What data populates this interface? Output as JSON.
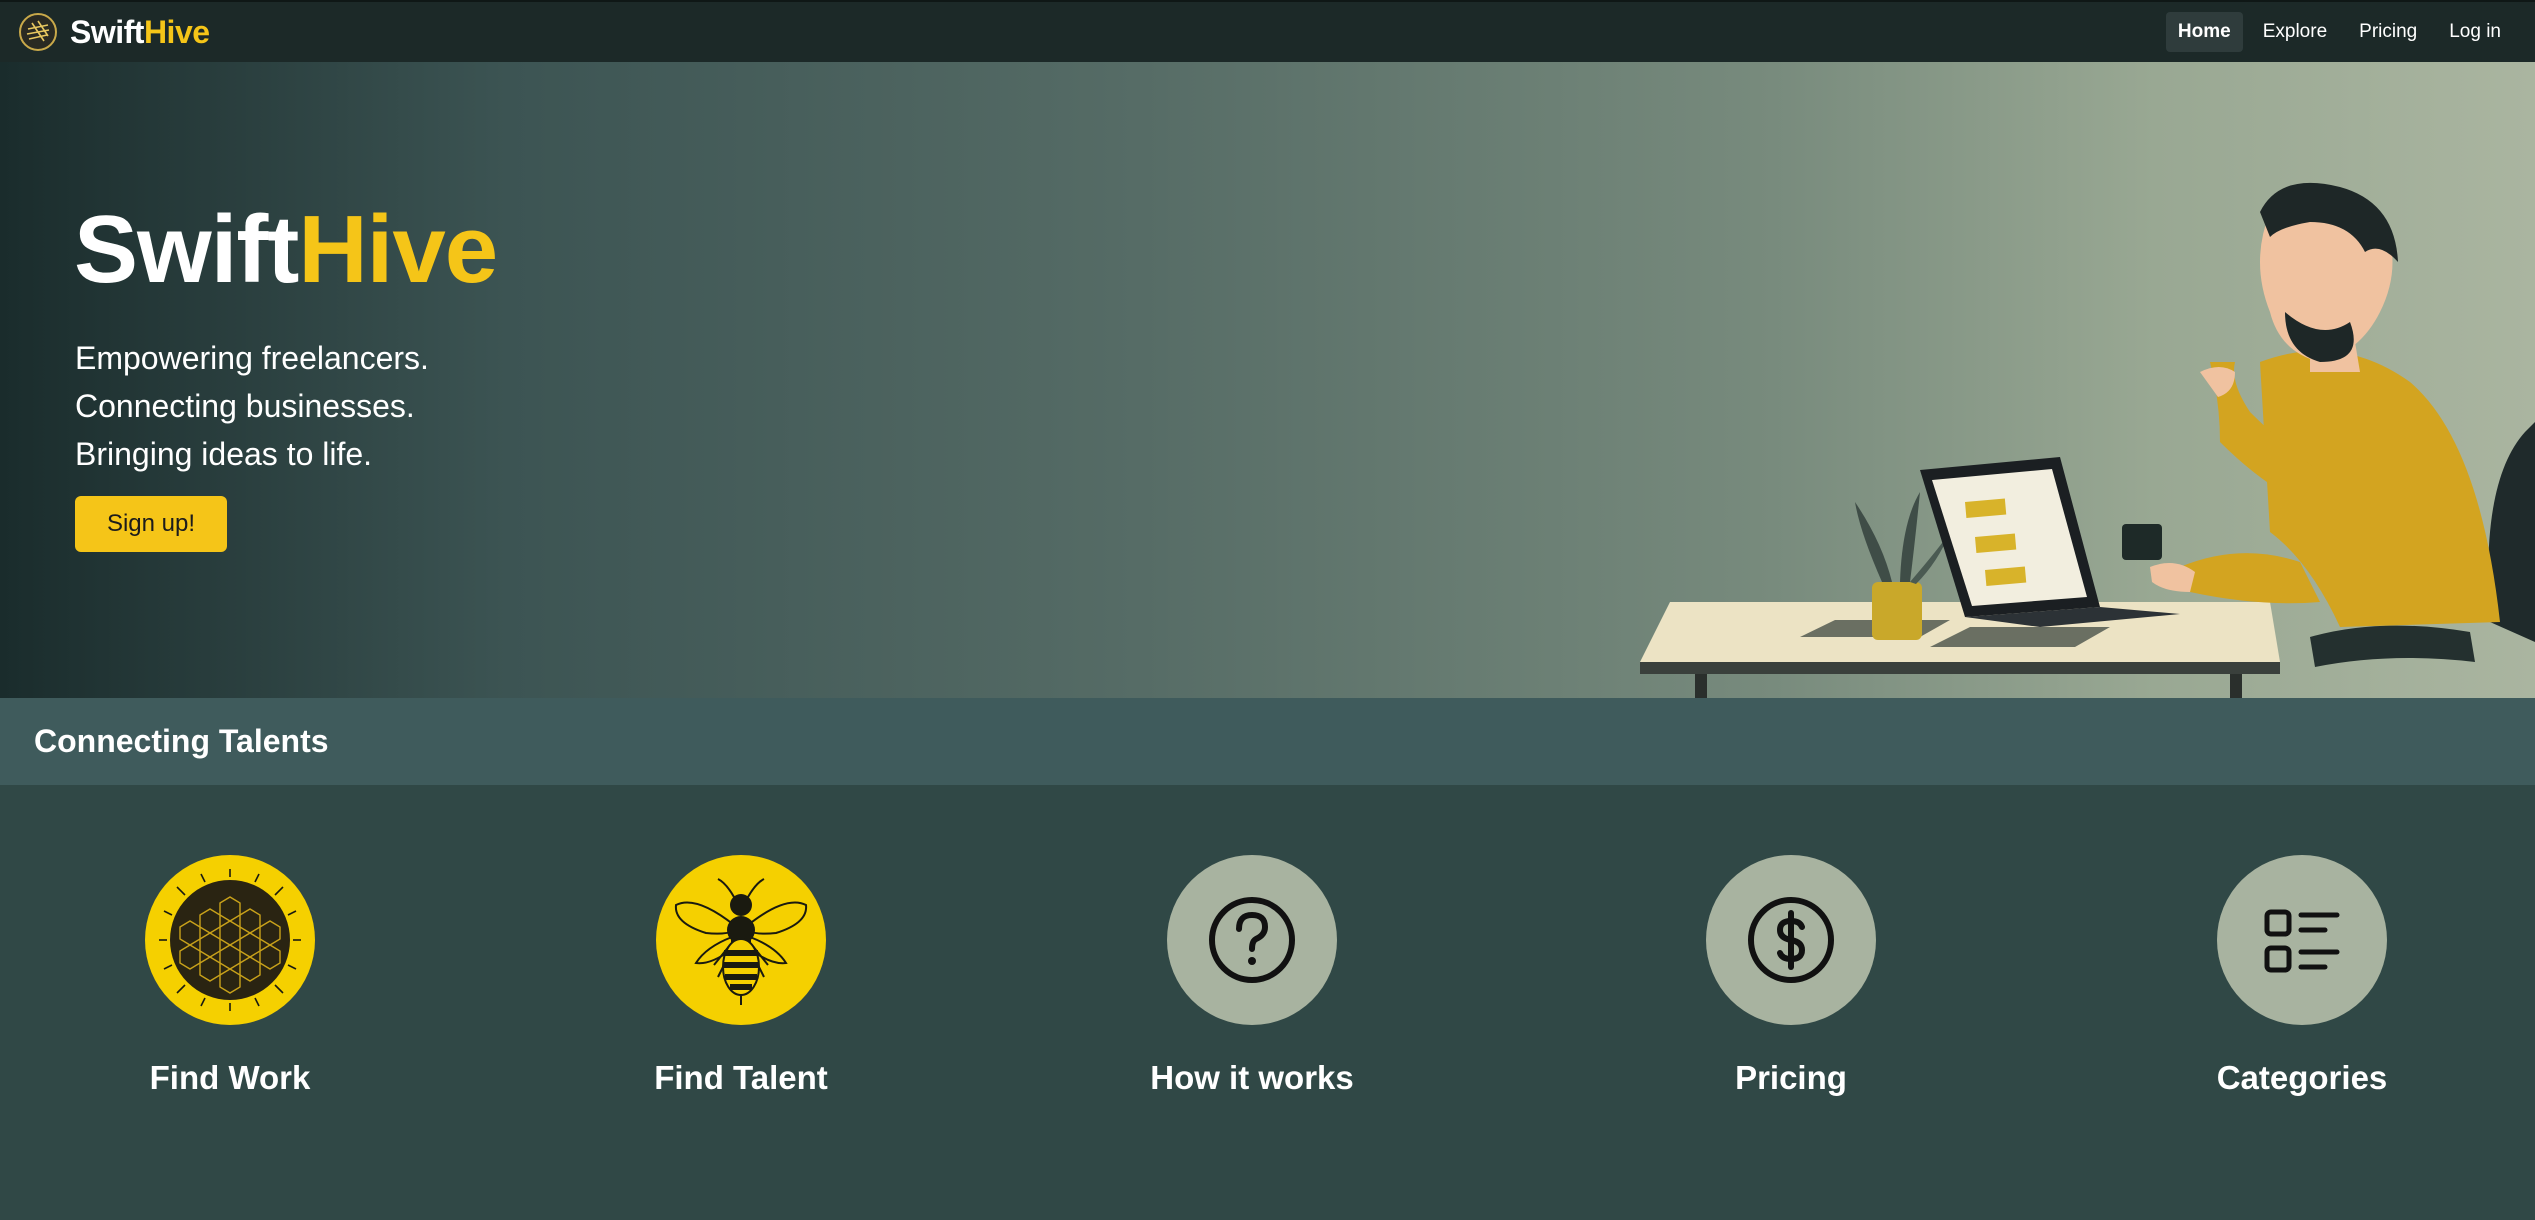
{
  "brand": {
    "name_part1": "Swift",
    "name_part2": "Hive",
    "logo_icon": "hive-logo-icon"
  },
  "nav": {
    "items": [
      {
        "label": "Home",
        "active": true
      },
      {
        "label": "Explore",
        "active": false
      },
      {
        "label": "Pricing",
        "active": false
      },
      {
        "label": "Log in",
        "active": false
      }
    ]
  },
  "hero": {
    "title_part1": "Swift",
    "title_part2": "Hive",
    "lines": [
      "Empowering freelancers.",
      "Connecting businesses.",
      "Bringing ideas to life."
    ],
    "cta_label": "Sign up!",
    "illustration_icon": "freelancer-at-desk-illustration"
  },
  "section": {
    "title": "Connecting Talents"
  },
  "features": [
    {
      "label": "Find Work",
      "icon": "honeycomb-icon",
      "circle_color": "#f5d000"
    },
    {
      "label": "Find Talent",
      "icon": "bee-icon",
      "circle_color": "#f5d000"
    },
    {
      "label": "How it works",
      "icon": "question-mark-icon",
      "circle_color": "#a8b3a0"
    },
    {
      "label": "Pricing",
      "icon": "dollar-icon",
      "circle_color": "#a8b3a0"
    },
    {
      "label": "Categories",
      "icon": "list-icon",
      "circle_color": "#a8b3a0"
    }
  ],
  "colors": {
    "accent": "#f5c518",
    "navbar": "#1c2928",
    "section_bar": "#3f5b5c",
    "body": "#304846"
  }
}
